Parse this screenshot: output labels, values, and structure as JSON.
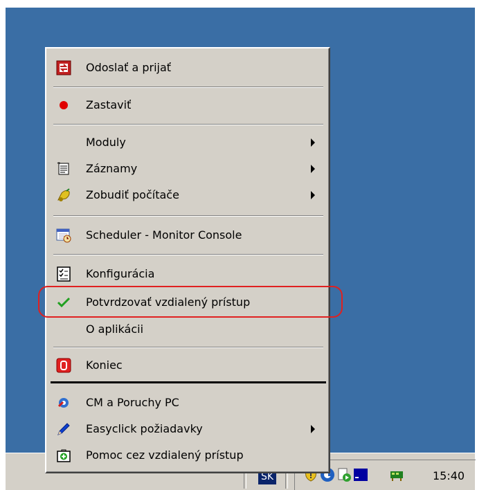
{
  "menu": {
    "items": [
      {
        "label": "Odoslať a prijať",
        "icon": "send-receive-icon"
      },
      {
        "label": "Zastaviť",
        "icon": "stop-icon"
      },
      {
        "label": "Moduly",
        "icon": "",
        "submenu": true
      },
      {
        "label": "Záznamy",
        "icon": "logs-icon",
        "submenu": true
      },
      {
        "label": "Zobudiť počítače",
        "icon": "wake-icon",
        "submenu": true
      },
      {
        "label": "Scheduler - Monitor Console",
        "icon": "scheduler-icon"
      },
      {
        "label": "Konfigurácia",
        "icon": "config-icon"
      },
      {
        "label": "Potvrdzovať vzdialený prístup",
        "icon": "checkmark-icon",
        "checked": true
      },
      {
        "label": "O aplikácii",
        "icon": ""
      },
      {
        "label": "Koniec",
        "icon": "exit-icon"
      },
      {
        "label": "CM a Poruchy PC",
        "icon": "cm-icon"
      },
      {
        "label": "Easyclick požiadavky",
        "icon": "pen-icon",
        "submenu": true
      },
      {
        "label": "Pomoc cez vzdialený prístup",
        "icon": "remote-help-icon"
      }
    ]
  },
  "taskbar": {
    "language": "SK",
    "clock": "15:40"
  },
  "colors": {
    "desktop": "#3a6ea5",
    "menu_bg": "#d4d0c8",
    "highlight": "#e02020"
  }
}
